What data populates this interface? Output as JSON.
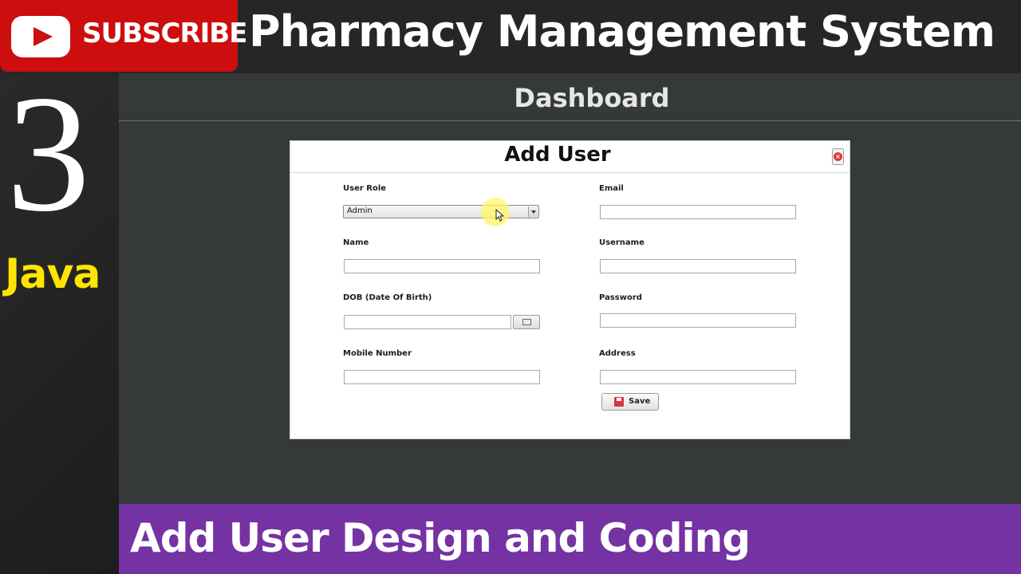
{
  "thumbnail": {
    "subscribe_label": "SUBSCRIBE",
    "main_title": "Pharmacy Management System",
    "episode_number": "3",
    "language": "Java",
    "bottom_title": "Add User Design and Coding"
  },
  "app": {
    "header_title": "Dashboard"
  },
  "dialog": {
    "title": "Add User",
    "fields": {
      "user_role": {
        "label": "User Role",
        "value": "Admin"
      },
      "email": {
        "label": "Email",
        "value": ""
      },
      "name": {
        "label": "Name",
        "value": ""
      },
      "username": {
        "label": "Username",
        "value": ""
      },
      "dob": {
        "label": "DOB (Date Of Birth)",
        "value": ""
      },
      "password": {
        "label": "Password",
        "value": ""
      },
      "mobile_number": {
        "label": "Mobile Number",
        "value": ""
      },
      "address": {
        "label": "Address",
        "value": ""
      }
    },
    "save_label": "Save"
  },
  "colors": {
    "subscribe_red": "#cc0e0e",
    "language_yellow": "#ffe500",
    "banner_purple": "#7432a3",
    "app_background": "#353a39"
  },
  "icons": [
    "youtube-play-icon",
    "close-icon",
    "dropdown-arrow-icon",
    "calendar-icon",
    "save-icon",
    "mouse-cursor-icon"
  ]
}
